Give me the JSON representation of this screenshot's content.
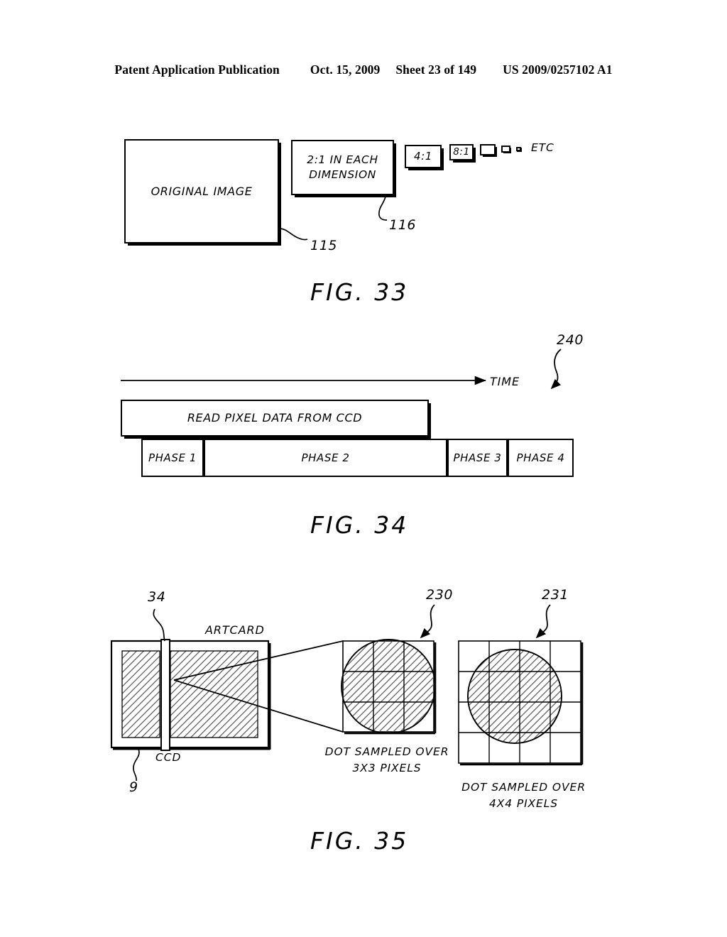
{
  "header": {
    "publication": "Patent Application Publication",
    "date": "Oct. 15, 2009",
    "sheet": "Sheet 23 of 149",
    "docnum": "US 2009/0257102 A1"
  },
  "fig33": {
    "caption": "FIG. 33",
    "original_image_label": "ORIGINAL IMAGE",
    "reduction_label_line1": "2:1 IN EACH",
    "reduction_label_line2": "DIMENSION",
    "ratio_4_1": "4:1",
    "ratio_8_1": "8:1",
    "etc_label": "ETC",
    "ref_115": "115",
    "ref_116": "116"
  },
  "fig34": {
    "caption": "FIG. 34",
    "time_axis_label": "TIME",
    "read_bar_label": "READ PIXEL DATA FROM CCD",
    "phases": [
      "PHASE 1",
      "PHASE 2",
      "PHASE 3",
      "PHASE 4"
    ],
    "ref_240": "240"
  },
  "fig35": {
    "caption": "FIG. 35",
    "artcard_label": "ARTCARD",
    "ccd_label": "CCD",
    "ref_34": "34",
    "ref_9": "9",
    "ref_230": "230",
    "ref_231": "231",
    "grid3_caption_line1": "DOT SAMPLED OVER",
    "grid3_caption_line2": "3X3 PIXELS",
    "grid4_caption_line1": "DOT SAMPLED OVER",
    "grid4_caption_line2": "4X4 PIXELS"
  },
  "colors": {
    "ink": "#000000",
    "paper": "#ffffff",
    "hatch": "#6d6d6d"
  }
}
